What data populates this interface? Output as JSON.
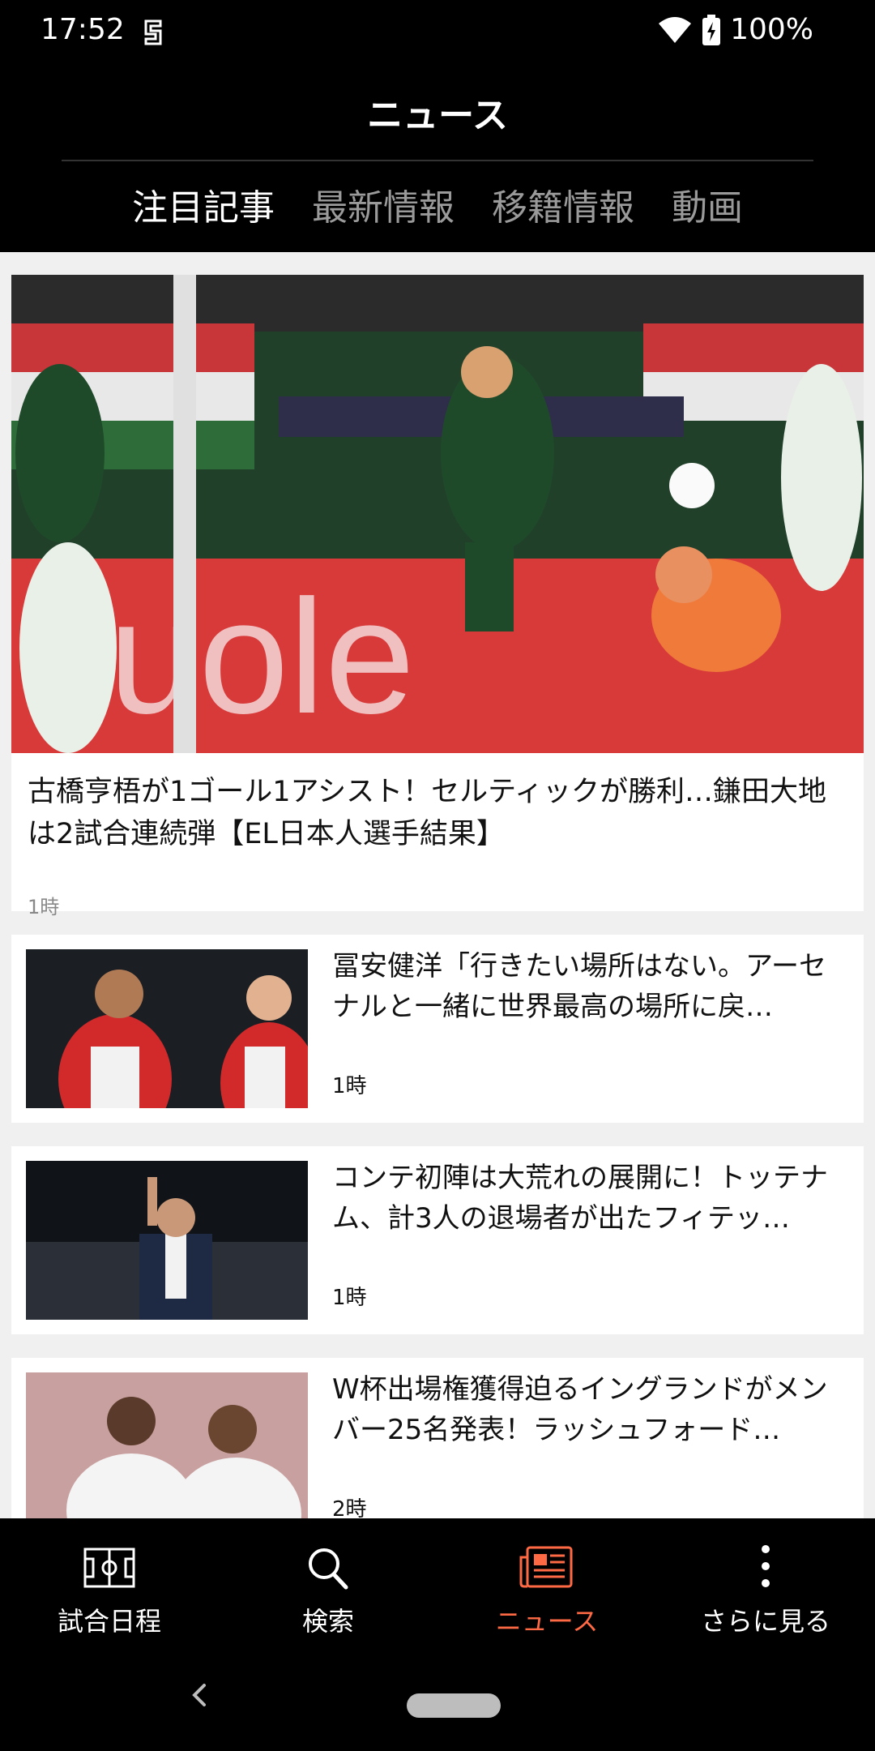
{
  "status_bar": {
    "time": "17:52",
    "battery": "100%"
  },
  "header": {
    "title": "ニュース"
  },
  "tabs": [
    {
      "label": "注目記事",
      "active": true
    },
    {
      "label": "最新情報",
      "active": false
    },
    {
      "label": "移籍情報",
      "active": false
    },
    {
      "label": "動画",
      "active": false
    }
  ],
  "hero": {
    "title": "古橋亨梧が1ゴール1アシスト！セルティックが勝利…鎌田大地は2試合連続弾【EL日本人選手結果】",
    "time": "1時"
  },
  "news": [
    {
      "title": "冨安健洋「行きたい場所はない。アーセナルと一緒に世界最高の場所に戻…",
      "time": "1時"
    },
    {
      "title": "コンテ初陣は大荒れの展開に！トッテナム、計3人の退場者が出たフィテッ…",
      "time": "1時"
    },
    {
      "title": "W杯出場権獲得迫るイングランドがメンバー25名発表！ラッシュフォード…",
      "time": "2時"
    }
  ],
  "bottom_nav": [
    {
      "label": "試合日程",
      "icon": "pitch-icon",
      "active": false
    },
    {
      "label": "検索",
      "icon": "search-icon",
      "active": false
    },
    {
      "label": "ニュース",
      "icon": "news-icon",
      "active": true
    },
    {
      "label": "さらに見る",
      "icon": "more-icon",
      "active": false
    }
  ],
  "colors": {
    "accent": "#ff6a45",
    "background": "#000000",
    "content_bg": "#f0f0f0"
  }
}
